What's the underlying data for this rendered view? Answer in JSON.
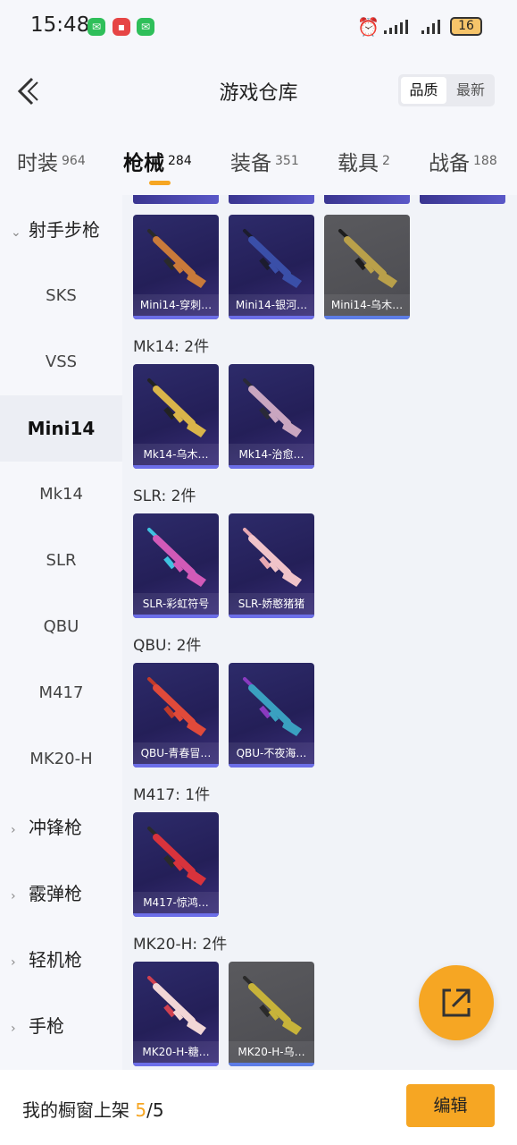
{
  "status": {
    "time": "15:48",
    "battery": "16"
  },
  "header": {
    "title": "游戏仓库",
    "sort_quality": "品质",
    "sort_newest": "最新"
  },
  "tabs": [
    {
      "label": "时装",
      "count": "964"
    },
    {
      "label": "枪械",
      "count": "284"
    },
    {
      "label": "装备",
      "count": "351"
    },
    {
      "label": "载具",
      "count": "2"
    },
    {
      "label": "战备",
      "count": "188"
    }
  ],
  "sidebar": {
    "category_open": "射手步枪",
    "items": [
      "SKS",
      "VSS",
      "Mini14",
      "Mk14",
      "SLR",
      "QBU",
      "M417",
      "MK20-H"
    ],
    "categories": [
      "冲锋枪",
      "霰弹枪",
      "轻机枪",
      "手枪"
    ]
  },
  "groups": [
    {
      "title": "",
      "items": [
        "Mini14-穿刺…",
        "Mini14-银河…",
        "Mini14-乌木…"
      ]
    },
    {
      "title": "Mk14: 2件",
      "items": [
        "Mk14-乌木…",
        "Mk14-治愈…"
      ]
    },
    {
      "title": "SLR: 2件",
      "items": [
        "SLR-彩虹符号",
        "SLR-娇憨猪猪"
      ]
    },
    {
      "title": "QBU: 2件",
      "items": [
        "QBU-青春冒…",
        "QBU-不夜海…"
      ]
    },
    {
      "title": "M417: 1件",
      "items": [
        "M417-惊鸿…"
      ]
    },
    {
      "title": "MK20-H: 2件",
      "items": [
        "MK20-H-糖…",
        "MK20-H-乌…"
      ]
    }
  ],
  "footer": {
    "showcase_label": "我的橱窗上架",
    "showcase_used": "5",
    "showcase_total": "/5",
    "edit_label": "编辑"
  },
  "colors": {
    "accent": "#f6a623",
    "card_purple": "#2d2b6a",
    "card_grey": "#5a5a5e"
  }
}
